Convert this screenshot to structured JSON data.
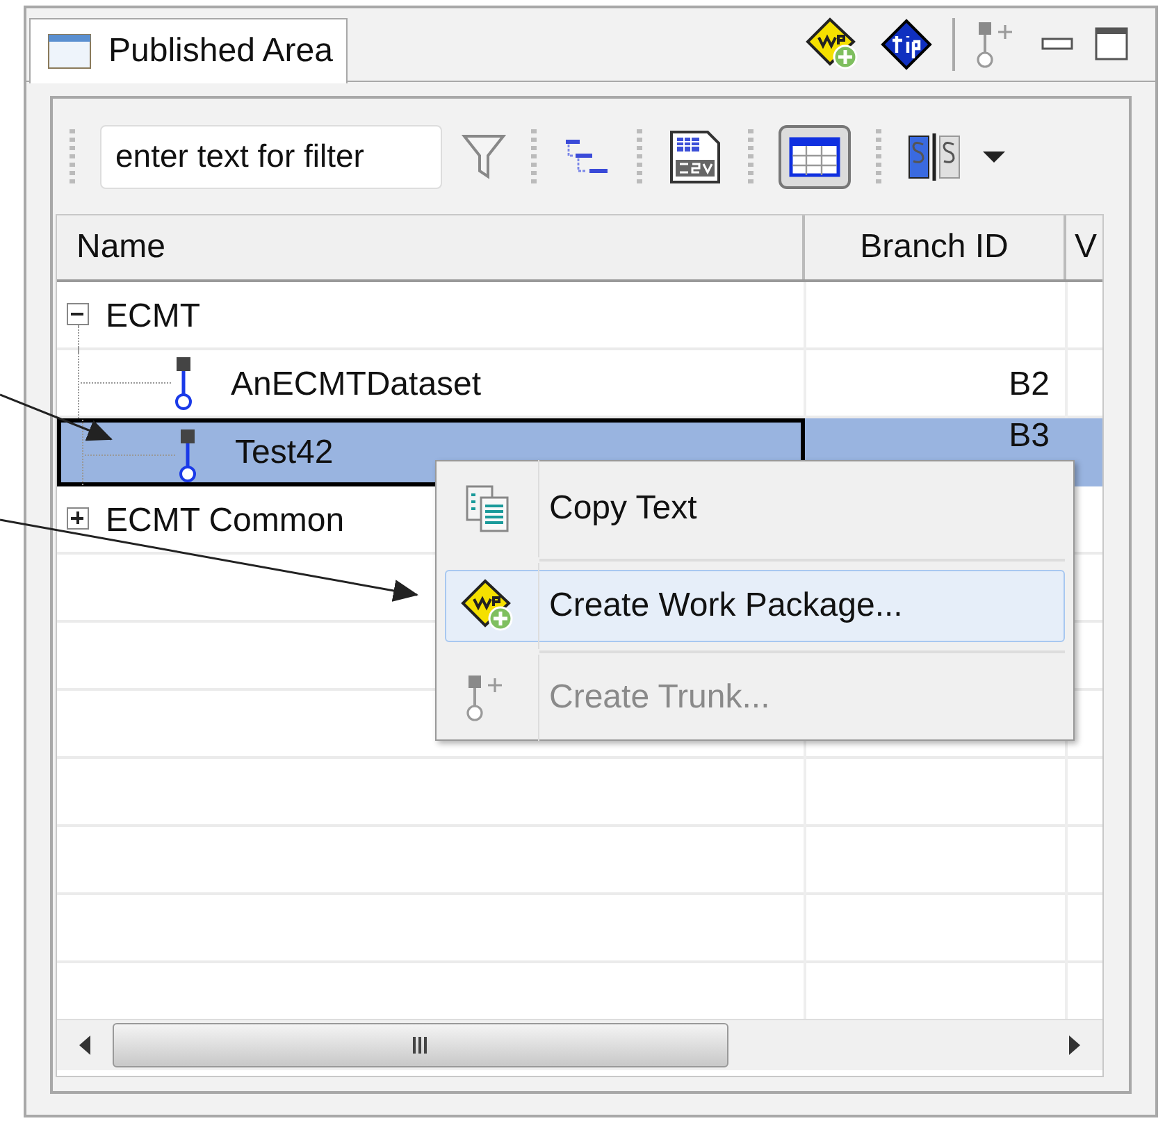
{
  "view_tab": {
    "title": "Published Area",
    "selected": true
  },
  "filter": {
    "placeholder": "enter text for filter"
  },
  "table_view_toggle": {
    "pressed": true
  },
  "table": {
    "columns": [
      "Name",
      "Branch ID",
      "V"
    ],
    "rows": [
      {
        "name": "ECMT",
        "expanded": true,
        "selected": false,
        "children": [
          {
            "name": "AnECMTDataset",
            "branch_id": "B2",
            "selected": false
          },
          {
            "name": "Test42",
            "branch_id": "B3",
            "selected": true
          }
        ]
      },
      {
        "name": "ECMT Common",
        "expanded": false,
        "selected": false
      }
    ]
  },
  "context_menu": [
    {
      "kind": "copy",
      "label": "Copy Text",
      "selected": false,
      "disabled": false
    },
    {
      "kind": "work-package",
      "label": "Create Work Package...",
      "selected": true,
      "disabled": false
    },
    {
      "kind": "trunk",
      "label": "Create Trunk...",
      "selected": false,
      "disabled": true
    }
  ]
}
